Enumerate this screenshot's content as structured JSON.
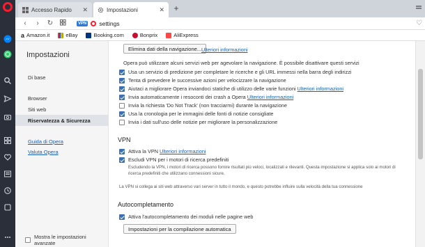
{
  "tabs": [
    {
      "label": "Accesso Rapido"
    },
    {
      "label": "Impostazioni"
    }
  ],
  "address": {
    "vpn_badge": "VPN",
    "url": "settings"
  },
  "bookmarks": [
    {
      "label": "Amazon.it",
      "color": "#222222"
    },
    {
      "label": "eBay",
      "color": "#e53238"
    },
    {
      "label": "Booking.com",
      "color": "#003580"
    },
    {
      "label": "Bonprix",
      "color": "#c8102e"
    },
    {
      "label": "AliExpress",
      "color": "#ff4747"
    }
  ],
  "sidebar": {
    "title": "Impostazioni",
    "items": [
      {
        "label": "Di base"
      },
      {
        "label": "Browser"
      },
      {
        "label": "Siti web"
      },
      {
        "label": "Riservatezza & Sicurezza"
      }
    ],
    "links": [
      {
        "label": "Guida di Opera"
      },
      {
        "label": "Valuta Opera"
      }
    ],
    "advanced": {
      "label": "Mostra le impostazioni avanzate",
      "checked": false
    }
  },
  "privacy": {
    "clear_button": "Elimina dati della navigazione...",
    "more_info": "Ulteriori informazioni",
    "intro": "Opera può utilizzare alcuni servizi web per agevolare la navigazione. È possibile disattivare questi servizi",
    "options": [
      {
        "label": "Usa un servizio di predizione per completare le ricerche e gli URL immessi nella barra degli indirizzi",
        "checked": true,
        "link": ""
      },
      {
        "label": "Tenta di prevedere le successive azioni per velocizzare la navigazione",
        "checked": true,
        "link": ""
      },
      {
        "label": "Aiutaci a migliorare Opera inviandoci statiche di utilizzo delle varie funzioni",
        "checked": true,
        "link": "Ulteriori informazioni"
      },
      {
        "label": "Invia automaticamente i resoconti dei crash a Opera",
        "checked": true,
        "link": "Ulteriori informazioni"
      },
      {
        "label": "Invia la richiesta 'Do Not Track' (non tracciarmi) durante la navigazione",
        "checked": false,
        "link": ""
      },
      {
        "label": "Usa la cronologia per le immagini delle fonti di notizie consigliate",
        "checked": true,
        "link": ""
      },
      {
        "label": "Invia i dati sull'uso delle notizie per migliorare la personalizzazione",
        "checked": false,
        "link": ""
      }
    ]
  },
  "vpn": {
    "heading": "VPN",
    "enable": {
      "label": "Attiva la VPN",
      "link": "Ulteriori informazioni",
      "checked": true
    },
    "bypass": {
      "label": "Escludi VPN per i motori di ricerca predefiniti",
      "checked": true
    },
    "bypass_note": "Escludendo la VPN, i motori di ricerca possono fornire risultati più veloci, localizzati e rilevanti. Questa impostazione si applica solo ai motori di ricerca predefiniti che utilizzano connessioni sicure.",
    "note": "La VPN si collega ai siti web attraverso vari server in tutto il mondo, e questo potrebbe influire sulla velocità della tua connessione"
  },
  "autocomplete": {
    "heading": "Autocompletamento",
    "enable": {
      "label": "Attiva l'autocompletamento dei moduli nelle pagine web",
      "checked": true
    },
    "button": "Impostazioni per la compilazione automatica"
  }
}
